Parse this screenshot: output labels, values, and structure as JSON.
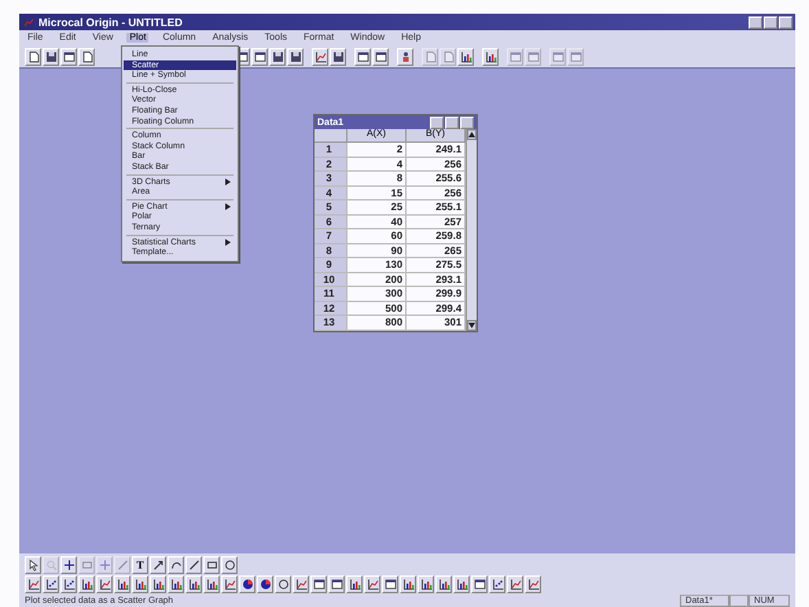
{
  "window": {
    "title": "Microcal Origin - UNTITLED"
  },
  "menu": [
    {
      "label": "File",
      "selected": false
    },
    {
      "label": "Edit",
      "selected": false
    },
    {
      "label": "View",
      "selected": false
    },
    {
      "label": "Plot",
      "selected": true
    },
    {
      "label": "Column",
      "selected": false
    },
    {
      "label": "Analysis",
      "selected": false
    },
    {
      "label": "Tools",
      "selected": false
    },
    {
      "label": "Format",
      "selected": false
    },
    {
      "label": "Window",
      "selected": false
    },
    {
      "label": "Help",
      "selected": false
    }
  ],
  "plot_menu": [
    {
      "kind": "item",
      "label": "Line",
      "selected": false,
      "submenu": false
    },
    {
      "kind": "item",
      "label": "Scatter",
      "selected": true,
      "submenu": false
    },
    {
      "kind": "item",
      "label": "Line + Symbol",
      "selected": false,
      "submenu": false
    },
    {
      "kind": "separator"
    },
    {
      "kind": "item",
      "label": "Hi-Lo-Close",
      "selected": false,
      "submenu": false
    },
    {
      "kind": "item",
      "label": "Vector",
      "selected": false,
      "submenu": false
    },
    {
      "kind": "item",
      "label": "Floating Bar",
      "selected": false,
      "submenu": false
    },
    {
      "kind": "item",
      "label": "Floating Column",
      "selected": false,
      "submenu": false
    },
    {
      "kind": "separator"
    },
    {
      "kind": "item",
      "label": "Column",
      "selected": false,
      "submenu": false
    },
    {
      "kind": "item",
      "label": "Stack Column",
      "selected": false,
      "submenu": false
    },
    {
      "kind": "item",
      "label": "Bar",
      "selected": false,
      "submenu": false
    },
    {
      "kind": "item",
      "label": "Stack Bar",
      "selected": false,
      "submenu": false
    },
    {
      "kind": "separator"
    },
    {
      "kind": "item",
      "label": "3D Charts",
      "selected": false,
      "submenu": true
    },
    {
      "kind": "item",
      "label": "Area",
      "selected": false,
      "submenu": false
    },
    {
      "kind": "separator"
    },
    {
      "kind": "item",
      "label": "Pie Chart",
      "selected": false,
      "submenu": true
    },
    {
      "kind": "item",
      "label": "Polar",
      "selected": false,
      "submenu": false
    },
    {
      "kind": "item",
      "label": "Ternary",
      "selected": false,
      "submenu": false
    },
    {
      "kind": "separator"
    },
    {
      "kind": "item",
      "label": "Statistical Charts",
      "selected": false,
      "submenu": true
    },
    {
      "kind": "item",
      "label": "Template...",
      "selected": false,
      "submenu": false
    }
  ],
  "worksheet": {
    "title": "Data1",
    "columns": [
      "A(X)",
      "B(Y)"
    ],
    "rows": [
      [
        "1",
        "2",
        "249.1"
      ],
      [
        "2",
        "4",
        "256"
      ],
      [
        "3",
        "8",
        "255.6"
      ],
      [
        "4",
        "15",
        "256"
      ],
      [
        "5",
        "25",
        "255.1"
      ],
      [
        "6",
        "40",
        "257"
      ],
      [
        "7",
        "60",
        "259.8"
      ],
      [
        "8",
        "90",
        "265"
      ],
      [
        "9",
        "130",
        "275.5"
      ],
      [
        "10",
        "200",
        "293.1"
      ],
      [
        "11",
        "300",
        "299.9"
      ],
      [
        "12",
        "500",
        "299.4"
      ],
      [
        "13",
        "800",
        "301"
      ]
    ]
  },
  "text_tool_label": "T",
  "status_bar": {
    "message": "Plot selected data as a Scatter Graph",
    "window": "Data1*",
    "mode": "NUM"
  }
}
